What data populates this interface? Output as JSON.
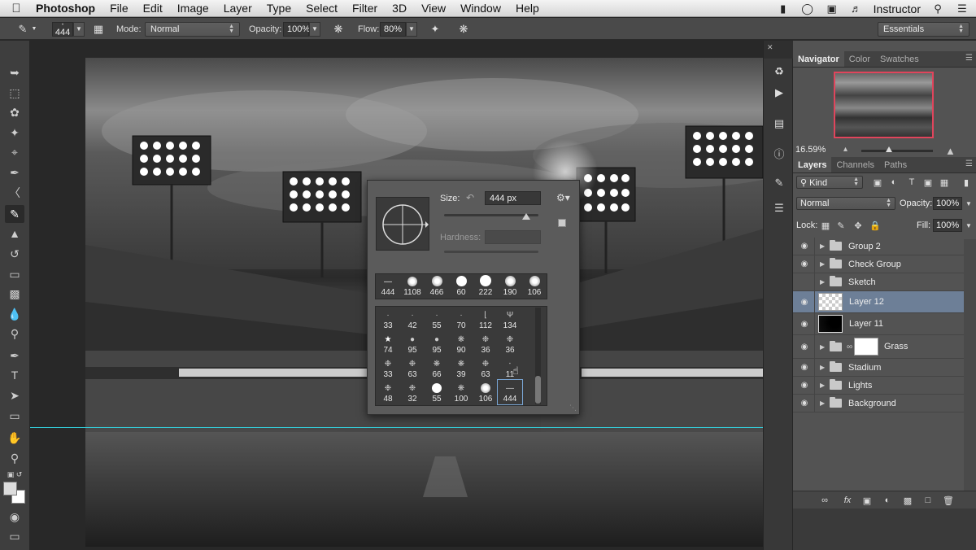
{
  "menubar": {
    "app_name": "Photoshop",
    "menus": [
      "File",
      "Edit",
      "Image",
      "Layer",
      "Type",
      "Select",
      "Filter",
      "3D",
      "View",
      "Window",
      "Help"
    ],
    "user": "Instructor"
  },
  "options_bar": {
    "brush_size": "444",
    "mode_label": "Mode:",
    "mode_value": "Normal",
    "opacity_label": "Opacity:",
    "opacity_value": "100%",
    "flow_label": "Flow:",
    "flow_value": "80%",
    "workspace": "Essentials"
  },
  "brush_picker": {
    "size_label": "Size:",
    "size_value": "444 px",
    "hardness_label": "Hardness:",
    "recent": [
      "444",
      "1108",
      "466",
      "60",
      "222",
      "190",
      "106"
    ],
    "presets": [
      [
        "33",
        "42",
        "55",
        "70",
        "112",
        "134"
      ],
      [
        "74",
        "95",
        "95",
        "90",
        "36",
        "36"
      ],
      [
        "33",
        "63",
        "66",
        "39",
        "63",
        "11"
      ],
      [
        "48",
        "32",
        "55",
        "100",
        "106",
        "444"
      ]
    ]
  },
  "navigator": {
    "tabs": [
      "Navigator",
      "Color",
      "Swatches"
    ],
    "zoom": "16.59%"
  },
  "layers_panel": {
    "tabs": [
      "Layers",
      "Channels",
      "Paths"
    ],
    "filter_kind": "Kind",
    "blend_mode": "Normal",
    "opacity_label": "Opacity:",
    "opacity_value": "100%",
    "lock_label": "Lock:",
    "fill_label": "Fill:",
    "fill_value": "100%",
    "layers": [
      {
        "name": "Group 2",
        "type": "group",
        "visible": true,
        "selected": false
      },
      {
        "name": "Check Group",
        "type": "group",
        "visible": true,
        "selected": false
      },
      {
        "name": "Sketch",
        "type": "group",
        "visible": false,
        "selected": false
      },
      {
        "name": "Layer 12",
        "type": "layer",
        "visible": true,
        "selected": true
      },
      {
        "name": "Layer 11",
        "type": "layer",
        "visible": true,
        "selected": false
      },
      {
        "name": "Grass",
        "type": "group-mask",
        "visible": true,
        "selected": false
      },
      {
        "name": "Stadium",
        "type": "group",
        "visible": true,
        "selected": false
      },
      {
        "name": "Lights",
        "type": "group",
        "visible": true,
        "selected": false
      },
      {
        "name": "Background",
        "type": "group",
        "visible": true,
        "selected": false
      }
    ]
  },
  "colors": {
    "accent_selected_layer": "#6d7f97",
    "guide_line": "#34d0dc",
    "navigator_view_box": "#e0455c"
  }
}
